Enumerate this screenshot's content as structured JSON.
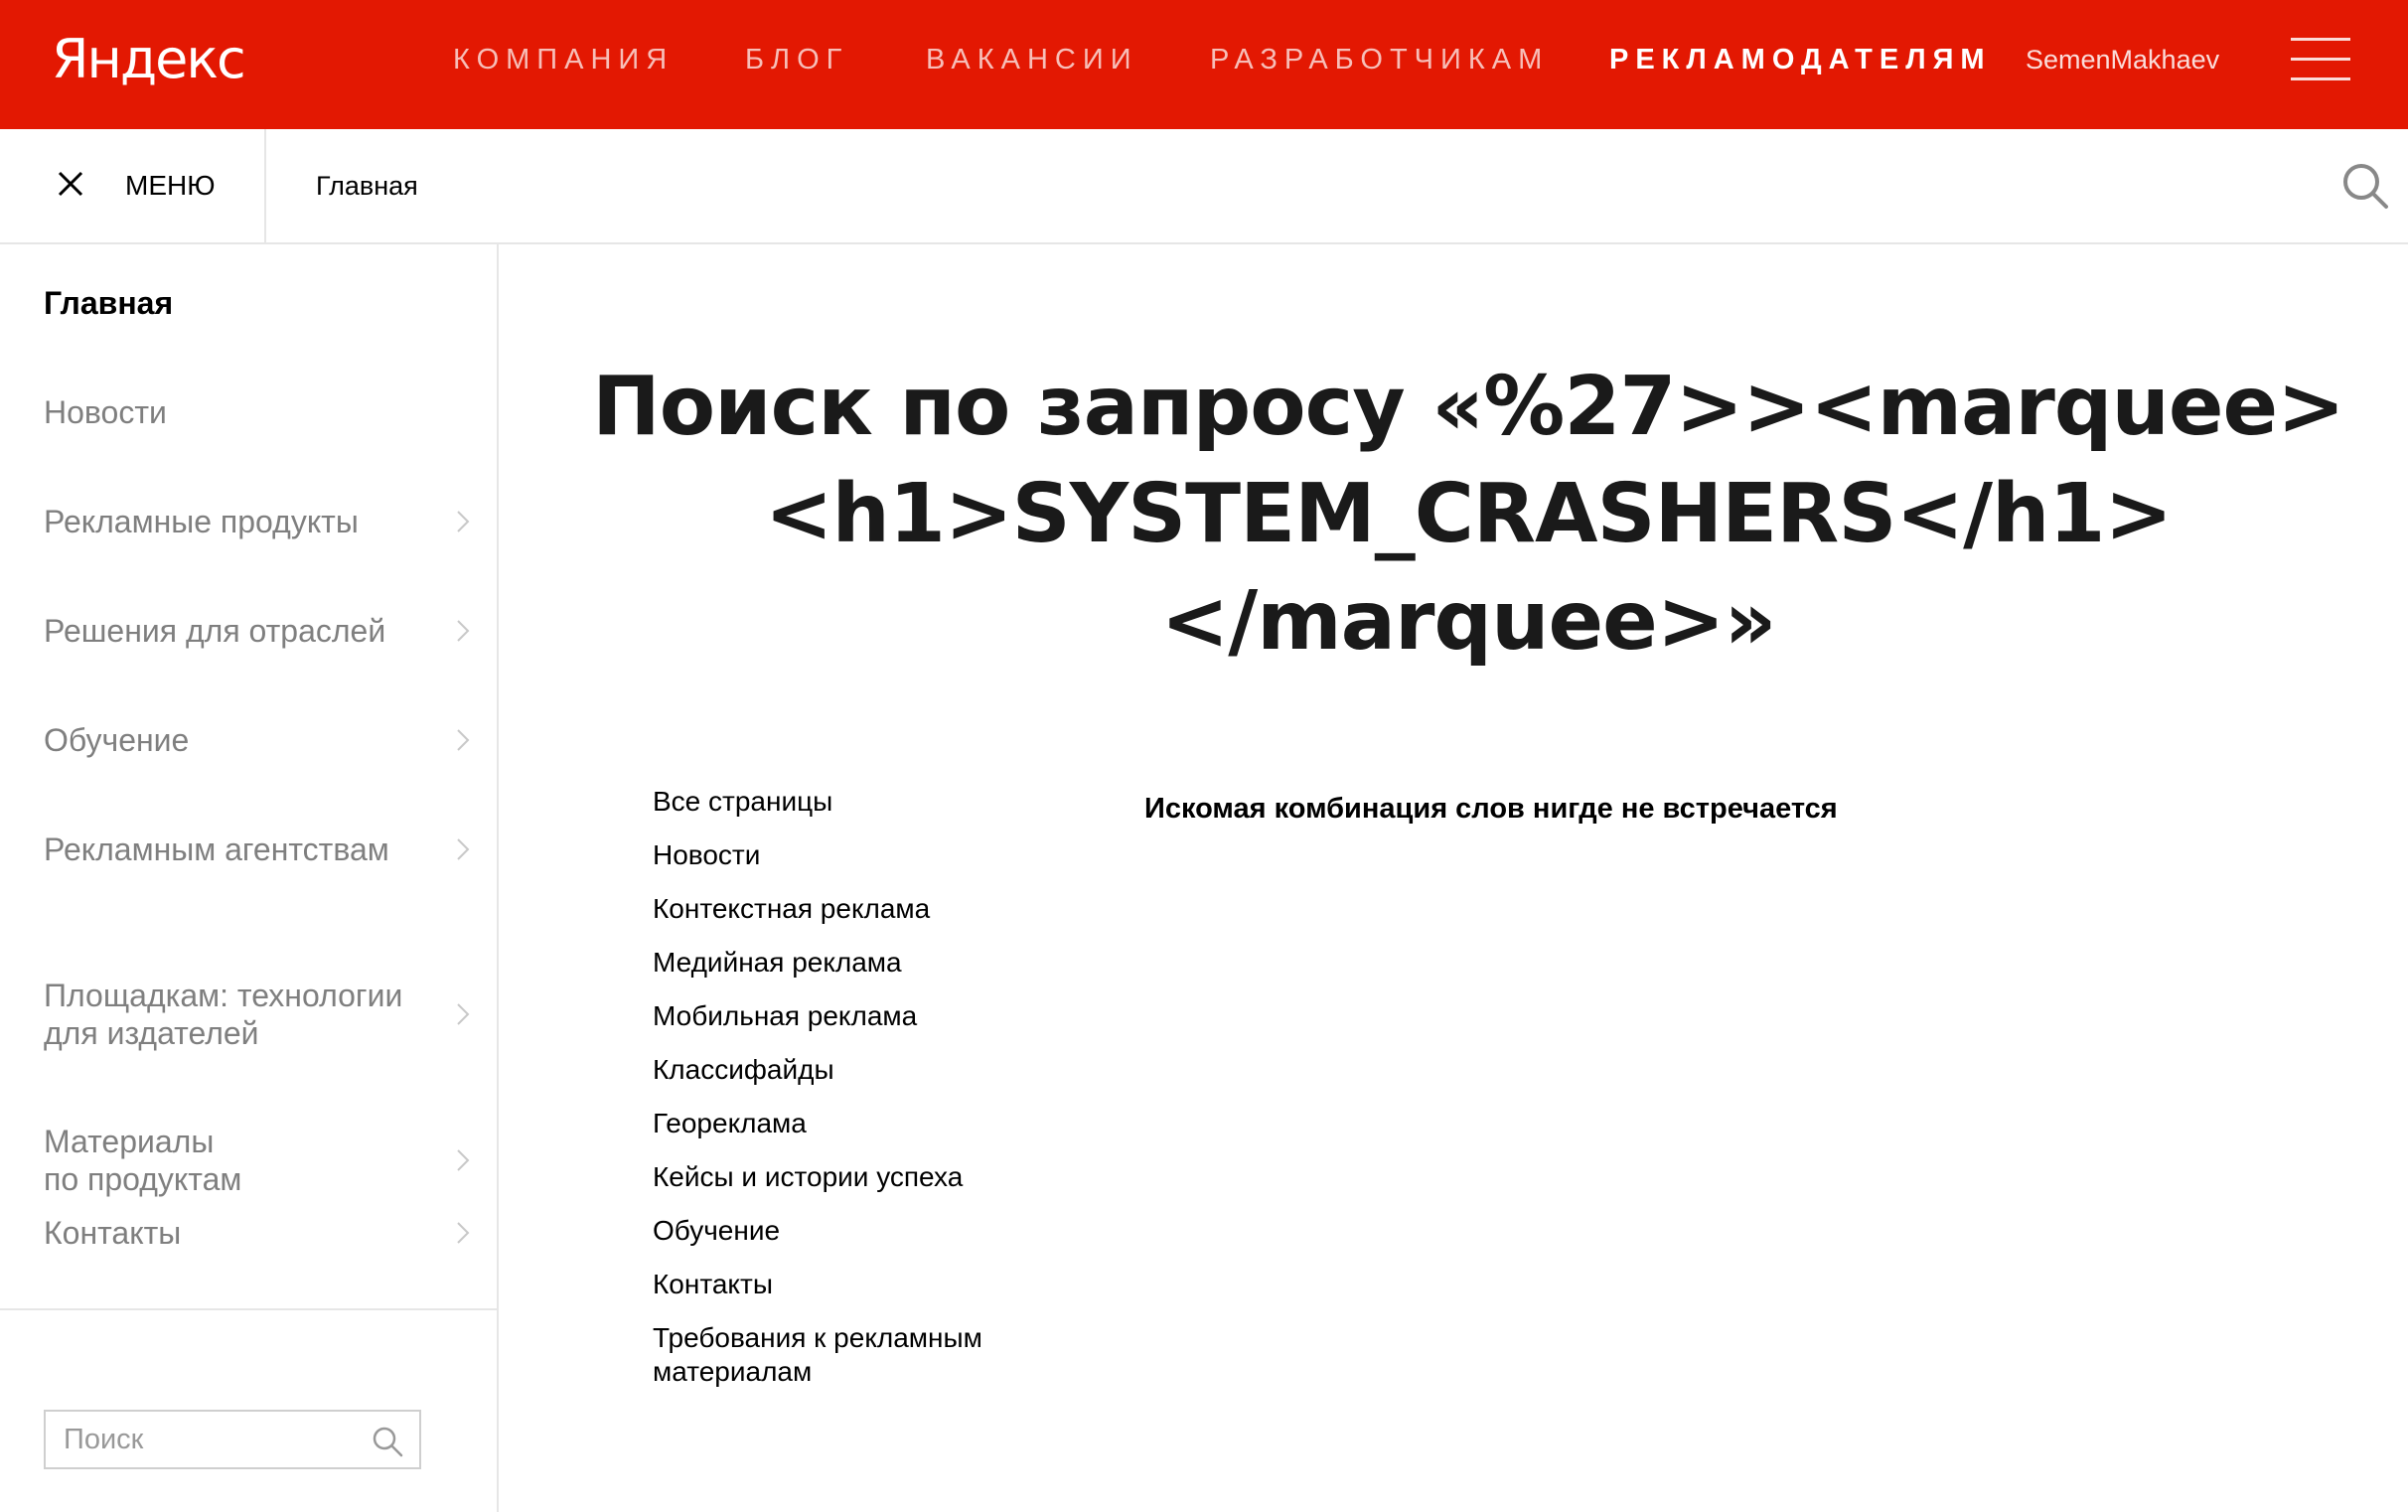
{
  "header": {
    "logo": "Яндекс",
    "nav": [
      {
        "label": "КОМПАНИЯ"
      },
      {
        "label": "БЛОГ"
      },
      {
        "label": "ВАКАНСИИ"
      },
      {
        "label": "РАЗРАБОТЧИКАМ"
      },
      {
        "label": "РЕКЛАМОДАТЕЛЯМ"
      }
    ],
    "active_nav": "РЕКЛАМОДАТЕЛЯМ",
    "user": "SemenMakhaev"
  },
  "subbar": {
    "menu_label": "МЕНЮ",
    "breadcrumb": "Главная"
  },
  "sidebar": {
    "items": [
      {
        "label": "Главная"
      },
      {
        "label": "Новости"
      },
      {
        "label": "Рекламные продукты"
      },
      {
        "label": "Решения для отраслей"
      },
      {
        "label": "Обучение"
      },
      {
        "label": "Рекламным агентствам"
      },
      {
        "label": "Площадкам: технологии\nдля издателей"
      },
      {
        "label": "Материалы\nпо продуктам"
      },
      {
        "label": "Контакты"
      }
    ],
    "search_placeholder": "Поиск"
  },
  "main": {
    "title": "Поиск по запросу «%27>><marquee><h1>SYSTEM_CRASHERS</h1></marquee>»",
    "title_lines": [
      "Поиск по запросу «%27>><marquee>",
      "<h1>SYSTEM_CRASHERS</h1>",
      "</marquee>»"
    ],
    "filters": [
      {
        "label": "Все страницы"
      },
      {
        "label": "Новости"
      },
      {
        "label": "Контекстная реклама"
      },
      {
        "label": "Медийная реклама"
      },
      {
        "label": "Мобильная реклама"
      },
      {
        "label": "Классифайды"
      },
      {
        "label": "Геореклама"
      },
      {
        "label": "Кейсы и истории успеха"
      },
      {
        "label": "Обучение"
      },
      {
        "label": "Контакты"
      },
      {
        "label": "Требования к рекламным\nматериалам"
      }
    ],
    "no_results": "Искомая комбинация слов нигде не встречается"
  },
  "colors": {
    "brand_red": "#e31802",
    "sidebar_text": "#7f7f7f",
    "divider": "#e6e6e6"
  }
}
